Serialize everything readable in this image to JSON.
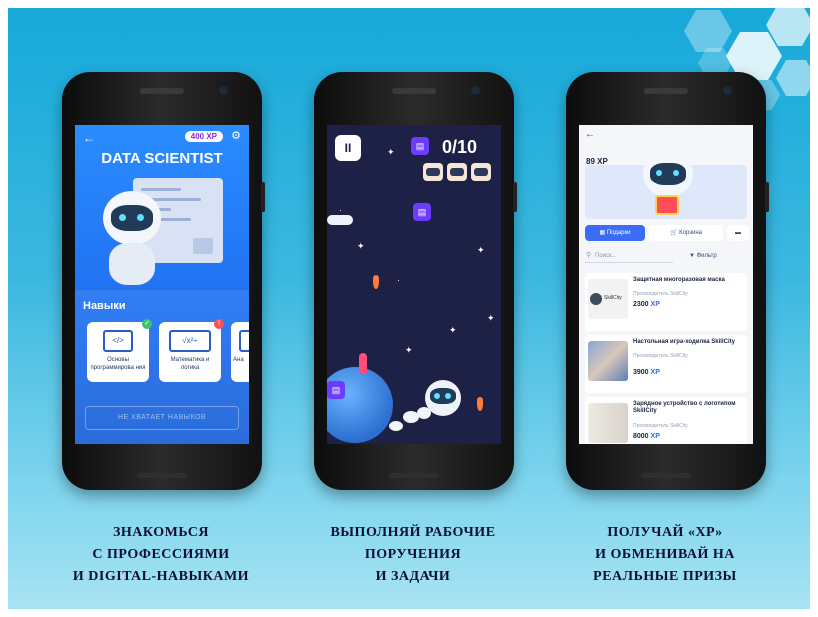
{
  "phone1": {
    "xp_badge": "400 XP",
    "title": "DATA SCIENTIST",
    "skills_heading": "Навыки",
    "cards": [
      {
        "icon": "code-window-icon",
        "icon_text": "</>",
        "label": "Основы программирова ния",
        "status": "check"
      },
      {
        "icon": "math-formula-icon",
        "icon_text": "√x²÷",
        "label": "Математика и логика",
        "status": "alert"
      },
      {
        "icon": "document-icon",
        "icon_text": "",
        "label": "Ана",
        "status": ""
      }
    ],
    "not_enough_button": "НЕ ХВАТАЕТ НАВЫКОВ"
  },
  "phone2": {
    "counter": "0/10"
  },
  "phone3": {
    "xp": "89 XP",
    "tabs": [
      "Подарки",
      "Корзина"
    ],
    "search_placeholder": "Поиск...",
    "filter_label": "Фильтр",
    "items": [
      {
        "name": "Защитная многоразовая маска",
        "maker": "Производитель SkillCity",
        "thumb_text": "SkillCity",
        "price": "2300",
        "currency": "XP"
      },
      {
        "name": "Настольная игра-ходилка SkillCity",
        "maker": "Производитель SkillCity",
        "thumb_text": "",
        "price": "3900",
        "currency": "XP"
      },
      {
        "name": "Зарядное устройство с логотипом SkillCity",
        "maker": "Производитель SkillCity",
        "thumb_text": "",
        "price": "8000",
        "currency": "XP"
      }
    ]
  },
  "captions": [
    {
      "line1": "ЗНАКОМЬСЯ",
      "line2": "С ПРОФЕССИЯМИ",
      "line3": "И DIGITAL-НАВЫКАМИ"
    },
    {
      "line1": "ВЫПОЛНЯЙ РАБОЧИЕ",
      "line2": "ПОРУЧЕНИЯ",
      "line3": "И ЗАДАЧИ"
    },
    {
      "line1": "ПОЛУЧАЙ «XP»",
      "line2": "И ОБМЕНИВАЙ НА",
      "line3": "РЕАЛЬНЫЕ ПРИЗЫ"
    }
  ],
  "colors": {
    "background_top": "#17a9d9",
    "background_bottom": "#a8e3f3",
    "app_blue": "#2b8cff",
    "game_bg": "#1c2145",
    "accent_purple": "#6b3cff"
  }
}
